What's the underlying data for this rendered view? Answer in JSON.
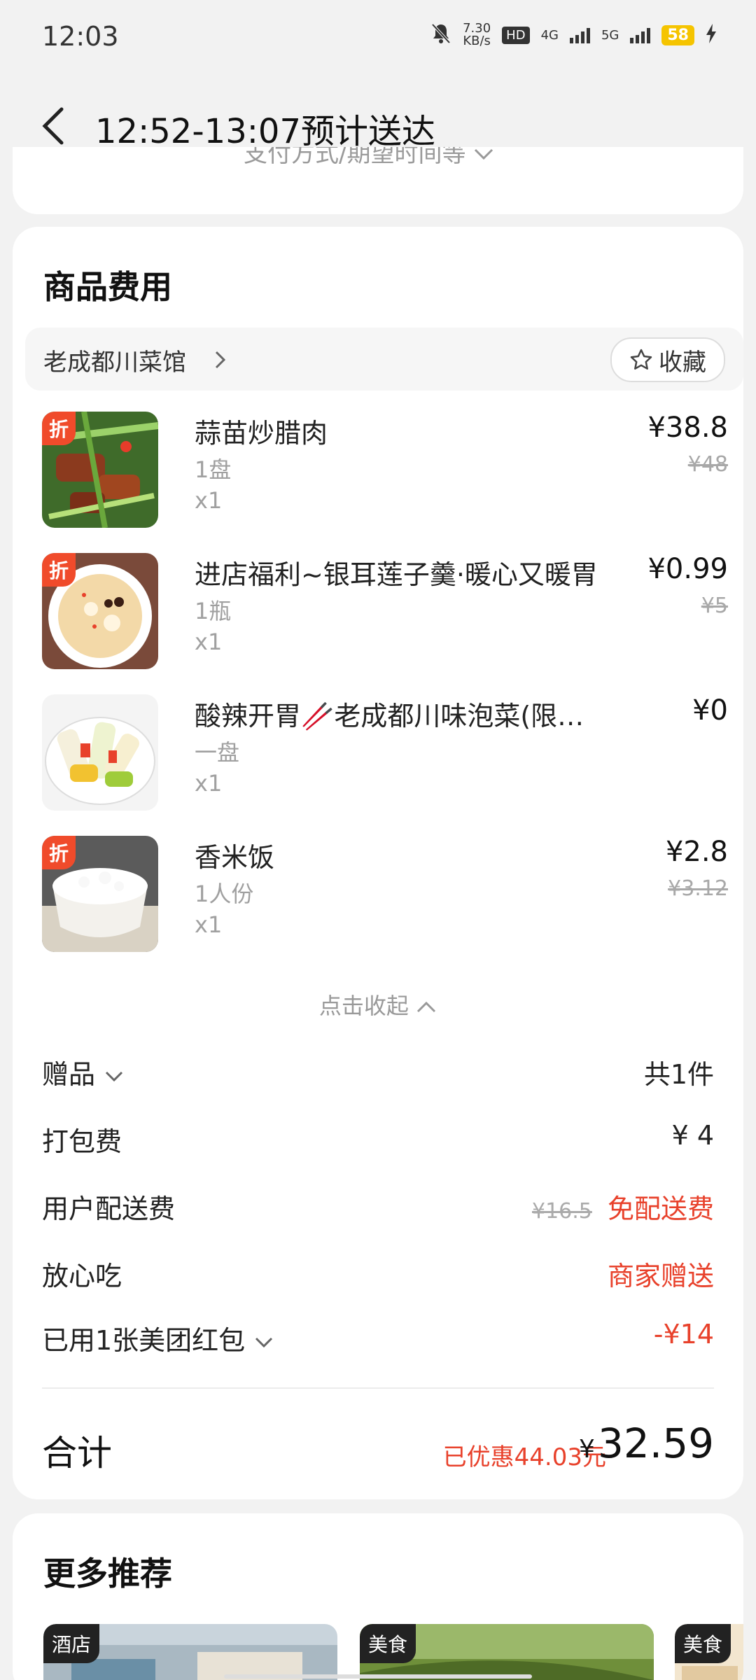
{
  "status_bar": {
    "time": "12:03",
    "speed_value": "7.30",
    "speed_unit": "KB/s",
    "hd": "HD",
    "net1": "4G",
    "net2": "5G",
    "battery": "58"
  },
  "header": {
    "title": "12:52-13:07预计送达",
    "peek_text": "支付方式/期望时间等"
  },
  "costs": {
    "section_title": "商品费用",
    "shop_name": "老成都川菜馆",
    "favorite_label": "收藏",
    "badge_label": "折",
    "items": [
      {
        "name": "蒜苗炒腊肉",
        "spec": "1盘",
        "qty": "x1",
        "price": "¥38.8",
        "original": "¥48",
        "discount": true
      },
      {
        "name": "进店福利~银耳莲子羹·暖心又暖胃",
        "spec": "1瓶",
        "qty": "x1",
        "price": "¥0.99",
        "original": "¥5",
        "discount": true
      },
      {
        "name": "酸辣开胃🥢老成都川味泡菜(限…",
        "spec": "一盘",
        "qty": "x1",
        "price": "¥0",
        "original": "",
        "discount": false
      },
      {
        "name": "香米饭",
        "spec": "1人份",
        "qty": "x1",
        "price": "¥2.8",
        "original": "¥3.12",
        "discount": true
      }
    ],
    "collapse_label": "点击收起",
    "gift_label": "赠品",
    "gift_value": "共1件",
    "packing_label": "打包费",
    "packing_value": "¥ 4",
    "delivery_label": "用户配送费",
    "delivery_original": "¥16.5",
    "delivery_value": "免配送费",
    "assurance_label": "放心吃",
    "assurance_value": "商家赠送",
    "redpacket_label": "已用1张美团红包",
    "redpacket_value": "-¥14",
    "total_label": "合计",
    "saved_text": "已优惠44.03元",
    "total_currency": "¥",
    "total_value": "32.59"
  },
  "more": {
    "title": "更多推荐",
    "tags": [
      "酒店",
      "美食",
      "美食"
    ]
  },
  "colors": {
    "accent_red": "#e8412b",
    "badge_orange": "#f04b2b",
    "battery_yellow": "#f5c400"
  }
}
